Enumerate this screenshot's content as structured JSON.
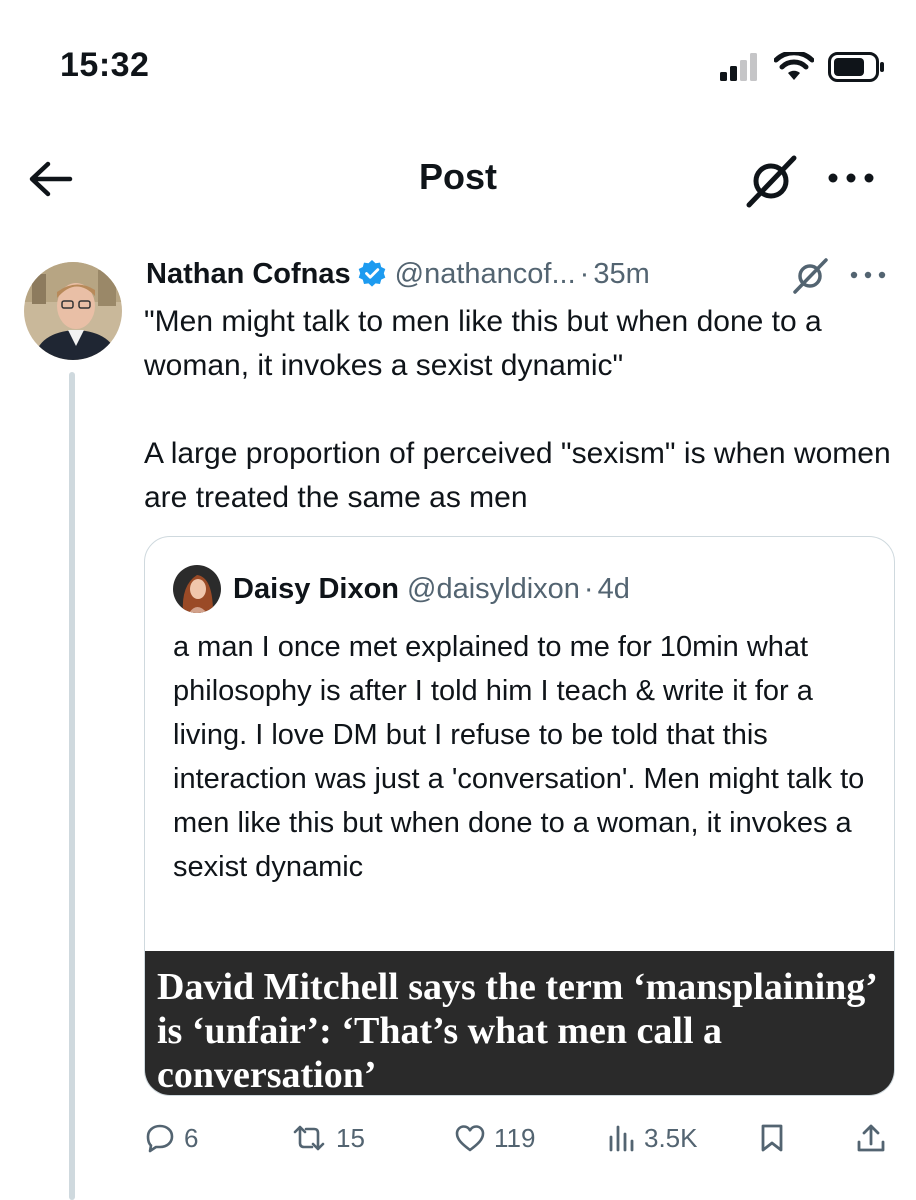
{
  "status_bar": {
    "time": "15:32",
    "icons": [
      "signal-icon",
      "wifi-icon",
      "battery-icon"
    ]
  },
  "nav": {
    "title": "Post",
    "back_icon": "arrow-left-icon",
    "grok_icon": "grok-icon",
    "more_icon": "more-horizontal-icon"
  },
  "post": {
    "author_name": "Nathan Cofnas",
    "handle": "@nathancof...",
    "separator": "·",
    "time": "35m",
    "verified": true,
    "paragraphs": [
      "\"Men might talk to men like this but when done to a woman, it invokes a sexist dynamic\"",
      "A large proportion of perceived \"sexism\" is when women are treated the same as men"
    ],
    "quoted": {
      "author_name": "Daisy Dixon",
      "handle": "@daisyldixon",
      "separator": "·",
      "time": "4d",
      "text": "a man I once met explained to me for 10min what philosophy is after I told him I teach & write it for a living. I love DM but I refuse to be told that this interaction was just a 'conversation'. Men might talk to men like this but when done to a woman, it invokes a sexist dynamic",
      "media_headline": "David Mitchell says the term ‘mansplaining’ is ‘unfair’: ‘That’s what men call a conversation’"
    },
    "actions": {
      "replies": "6",
      "reposts": "15",
      "likes": "119",
      "views": "3.5K"
    }
  },
  "colors": {
    "text": "#0f1419",
    "secondary": "#536471",
    "verified": "#1d9bf0",
    "border": "#cfd9de",
    "media_bg": "#2a2a2a"
  }
}
